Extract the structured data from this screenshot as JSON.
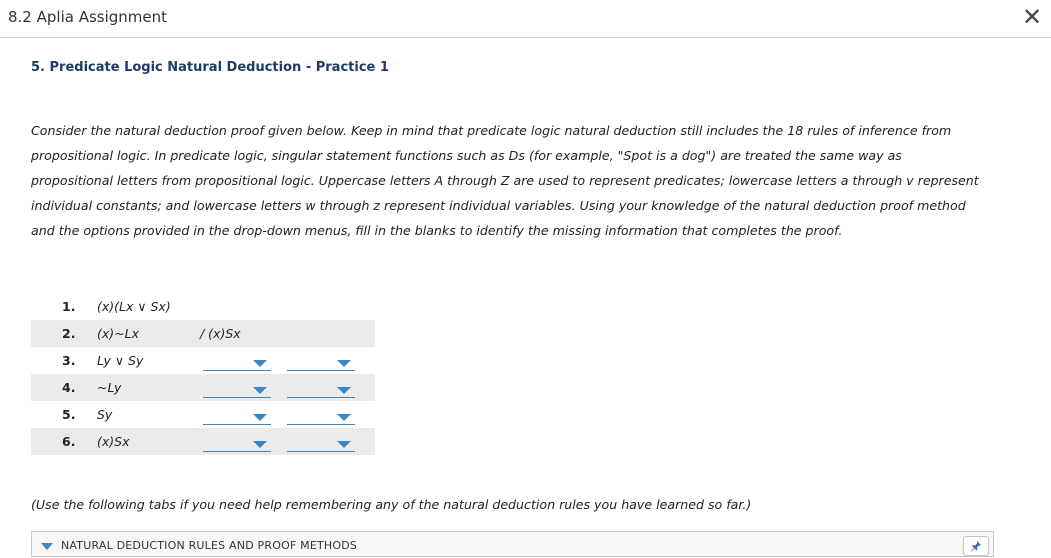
{
  "window": {
    "title": "8.2 Aplia Assignment",
    "close_symbol": "✕"
  },
  "question": {
    "title": "5. Predicate Logic Natural Deduction - Practice 1",
    "instructions": [
      "Consider the natural deduction proof given below. Keep in mind that predicate logic natural deduction still includes the 18 rules of inference from",
      "propositional logic. In predicate logic, singular statement functions such as Ds (for example, \"Spot is a dog\") are treated the same way as",
      "propositional letters from propositional logic. Uppercase letters A through Z are used to represent predicates; lowercase letters a through v represent",
      "individual constants; and lowercase letters w through z represent individual variables. Using your knowledge of the natural deduction proof method",
      "and the options provided in the drop-down menus, fill in the blanks to identify the missing information that completes the proof."
    ]
  },
  "proof": {
    "conclusion": "/ (x)Sx",
    "lines": [
      {
        "num": "1.",
        "statement": "(x)(Lx ∨ Sx)"
      },
      {
        "num": "2.",
        "statement": "(x)~Lx"
      },
      {
        "num": "3.",
        "statement": "Ly ∨ Sy"
      },
      {
        "num": "4.",
        "statement": "~Ly"
      },
      {
        "num": "5.",
        "statement": "Sy"
      },
      {
        "num": "6.",
        "statement": "(x)Sx"
      }
    ]
  },
  "hint": "(Use the following tabs if you need help remembering any of the natural deduction rules you have learned so far.)",
  "tabs": {
    "label": "NATURAL DEDUCTION RULES AND PROOF METHODS",
    "pin_icon": "pin-icon"
  },
  "colors": {
    "accent": "#3a87c8",
    "title": "#1c3d6a",
    "row_shade": "#ebebeb"
  }
}
